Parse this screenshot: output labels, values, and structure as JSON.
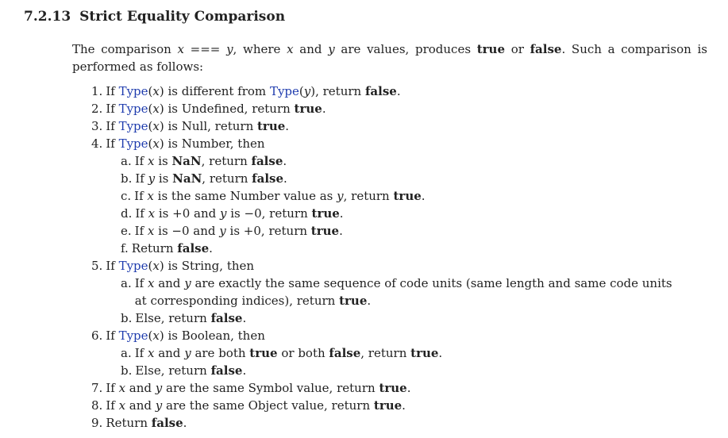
{
  "section": {
    "number": "7.2.13",
    "title": "Strict Equality Comparison"
  },
  "intro": {
    "p1": "The comparison ",
    "x": "x",
    "op": " === ",
    "y": "y",
    "p2": ", where ",
    "p3": " and ",
    "p4": " are values, produces ",
    "true": "true",
    "or": " or ",
    "false": "false",
    "p5": ". Such a comparison is performed as follows:"
  },
  "words": {
    "if": "If ",
    "type": "Type",
    "x": "x",
    "y": "y",
    "open": "(",
    "close": ")",
    "true": "true",
    "false": "false",
    "nan": "NaN",
    "plus0": "+0",
    "minus0": "−0"
  },
  "steps": [
    {
      "label": "1.",
      "mid": ") is different from ",
      "mid2": "), return ",
      "end": "."
    },
    {
      "label": "2.",
      "mid": ") is Undefined, return ",
      "end": "."
    },
    {
      "label": "3.",
      "mid": ") is Null, return ",
      "end": "."
    },
    {
      "label": "4.",
      "mid": ") is Number, then"
    },
    {
      "label": "5.",
      "mid": ") is String, then"
    },
    {
      "label": "6.",
      "mid": ") is Boolean, then"
    },
    {
      "label": "7.",
      "mid": " and ",
      "mid2": " are the same Symbol value, return ",
      "end": "."
    },
    {
      "label": "8.",
      "mid": " and ",
      "mid2": " are the same Object value, return ",
      "end": "."
    },
    {
      "label": "9.",
      "text": "Return ",
      "end": "."
    }
  ],
  "number_steps": [
    {
      "label": "a.",
      "mid": " is ",
      "mid2": ", return ",
      "end": "."
    },
    {
      "label": "b.",
      "mid": " is ",
      "mid2": ", return ",
      "end": "."
    },
    {
      "label": "c.",
      "mid": " is the same Number value as ",
      "mid2": ", return ",
      "end": "."
    },
    {
      "label": "d.",
      "mid": " is ",
      "mid2": " and ",
      "mid3": " is ",
      "mid4": ", return ",
      "end": "."
    },
    {
      "label": "e.",
      "mid": " is ",
      "mid2": " and ",
      "mid3": " is ",
      "mid4": ", return ",
      "end": "."
    },
    {
      "label": "f.",
      "text": "Return ",
      "end": "."
    }
  ],
  "string_steps": [
    {
      "label": "a.",
      "mid": " and ",
      "mid2": " are exactly the same sequence of code units (same length and same code units at corresponding indices), return ",
      "end": "."
    },
    {
      "label": "b.",
      "text": "Else, return ",
      "end": "."
    }
  ],
  "boolean_steps": [
    {
      "label": "a.",
      "mid": " and ",
      "mid2": " are both ",
      "mid3": " or both ",
      "mid4": ", return ",
      "end": "."
    },
    {
      "label": "b.",
      "text": "Else, return ",
      "end": "."
    }
  ]
}
